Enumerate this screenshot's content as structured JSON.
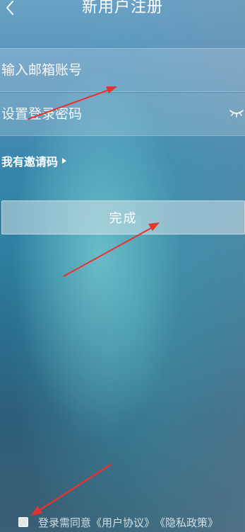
{
  "header": {
    "title": "新用户注册",
    "back_icon": "chevron-left-icon"
  },
  "form": {
    "email_placeholder": "输入邮箱账号",
    "email_value": "",
    "password_placeholder": "设置登录密码",
    "password_value": "",
    "password_toggle_icon": "eye-closed-icon"
  },
  "invite": {
    "label": "我有邀请码",
    "icon": "triangle-right-icon"
  },
  "submit": {
    "label": "完成"
  },
  "agreement": {
    "prefix": "登录需同意",
    "user_agreement": "《用户协议》",
    "privacy_policy": "《隐私政策》",
    "checked": false
  },
  "annotation": {
    "arrow_color": "#e8322c"
  },
  "colors": {
    "background_top": "#6aa2c6",
    "background_bottom": "#3b5f74",
    "text": "#ffffff"
  }
}
